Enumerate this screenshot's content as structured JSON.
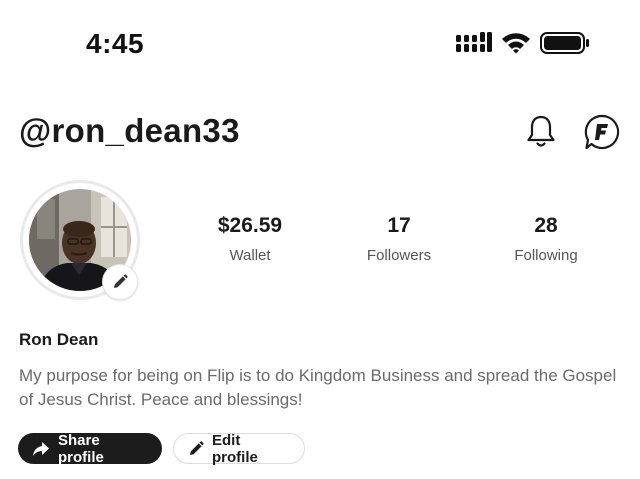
{
  "status_bar": {
    "time": "4:45",
    "icons": [
      "cellular-signal-icon",
      "wifi-icon",
      "battery-icon"
    ]
  },
  "header": {
    "username": "@ron_dean33",
    "icons": [
      "bell-icon",
      "flip-chat-icon"
    ]
  },
  "profile": {
    "avatar": "profile-photo",
    "edit_avatar_icon": "pencil-icon",
    "stats": {
      "wallet": {
        "value": "$26.59",
        "label": "Wallet"
      },
      "followers": {
        "value": "17",
        "label": "Followers"
      },
      "following": {
        "value": "28",
        "label": "Following"
      }
    },
    "display_name": "Ron Dean",
    "bio": "My purpose for being on Flip is to do Kingdom Business and spread the Gospel of Jesus Christ. Peace and blessings!"
  },
  "actions": {
    "share_label": "Share profile",
    "share_icon": "share-arrow-icon",
    "edit_label": "Edit profile",
    "edit_icon": "pencil-icon"
  },
  "colors": {
    "text_primary": "#1a1a1a",
    "text_secondary": "#6a6a6a",
    "share_button_bg": "#1c1c1c",
    "edit_button_border": "#dcdcdc"
  }
}
